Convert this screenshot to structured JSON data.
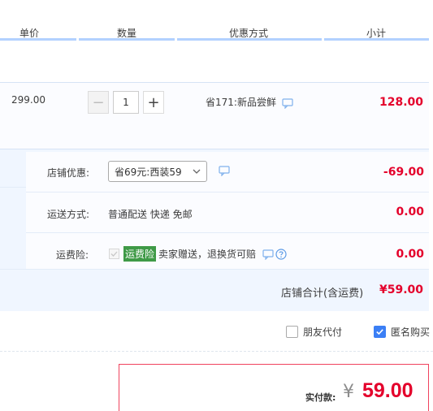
{
  "header": {
    "col_price": "单价",
    "col_qty": "数量",
    "col_promo": "优惠方式",
    "col_subtotal": "小计"
  },
  "item": {
    "price": "299.00",
    "quantity": "1",
    "minus": "−",
    "plus": "+",
    "promo": "省171:新品尝鲜",
    "subtotal": "128.00"
  },
  "shop": {
    "discount_label": "店铺优惠:",
    "discount_selected": "省69元:西装59",
    "discount_amount": "-69.00",
    "shipping_label": "运送方式:",
    "shipping_value": "普通配送 快递 免邮",
    "shipping_amount": "0.00",
    "insurance_label": "运费险:",
    "insurance_tag": "运费险",
    "insurance_text": "卖家赠送，退换货可赔",
    "insurance_amount": "0.00",
    "total_label": "店铺合计(含运费)",
    "total_amount": "¥59.00"
  },
  "options": {
    "friend_pay": "朋友代付",
    "friend_pay_checked": false,
    "anonymous": "匿名购买",
    "anonymous_checked": true
  },
  "payment": {
    "label": "实付款:",
    "currency": "¥",
    "amount": "59.00"
  },
  "colors": {
    "accent_red": "#e4002b",
    "header_bar": "#b2d1ff",
    "checkbox_blue": "#3b7ff5",
    "tag_green": "#3f9a47"
  }
}
